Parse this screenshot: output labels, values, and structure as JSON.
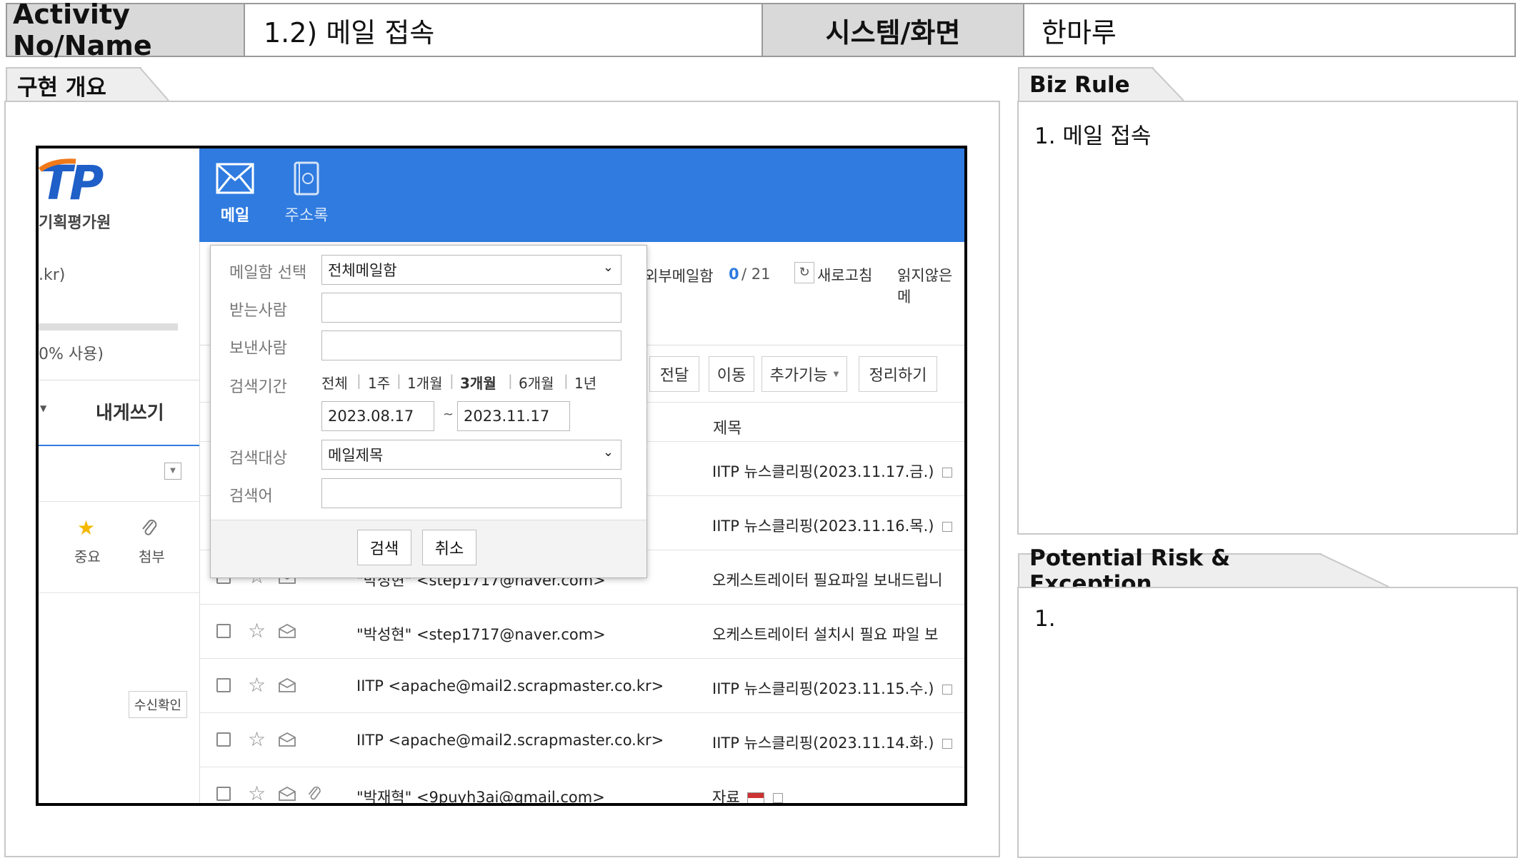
{
  "header": {
    "activity_label": "Activity No/Name",
    "activity_value": "1.2) 메일 접속",
    "system_label": "시스템/화면",
    "system_value": "한마루"
  },
  "sections": {
    "overview_title": "구현 개요",
    "biz_rule_title": "Biz Rule",
    "biz_rule_text": "1. 메일 접속",
    "risk_title": "Potential Risk & Exception",
    "risk_text": "1."
  },
  "mail_ui": {
    "logo_text": "TP",
    "org_name": "기획평가원",
    "nav": [
      {
        "label": "메일",
        "icon": "envelope-icon"
      },
      {
        "label": "주소록",
        "icon": "address-book-icon"
      }
    ],
    "account_suffix": ".kr)",
    "usage_text": "0% 사용)",
    "compose_label": "내게쓰기",
    "filters": {
      "important": "중요",
      "attachment": "첨부"
    },
    "receipt_label": "수신확인",
    "external_mailbox_label": "외부메일함",
    "external_count_unread": "0",
    "external_count_total": "/ 21",
    "refresh_label": "새로고침",
    "unread_label": "읽지않은메",
    "toolbar": [
      "전달",
      "이동",
      "추가기능",
      "정리하기"
    ],
    "subject_header": "제목",
    "rows": [
      {
        "sender": "",
        "subject": "IITP 뉴스클리핑(2023.11.17.금.)"
      },
      {
        "sender": "",
        "subject": "IITP 뉴스클리핑(2023.11.16.목.)"
      },
      {
        "sender": "\"박성현\" <step1717@naver.com>",
        "subject": "오케스트레이터 필요파일 보내드립니"
      },
      {
        "sender": "\"박성현\" <step1717@naver.com>",
        "subject": "오케스트레이터 설치시 필요 파일 보"
      },
      {
        "sender": "IITP <apache@mail2.scrapmaster.co.kr>",
        "subject": "IITP 뉴스클리핑(2023.11.15.수.)"
      },
      {
        "sender": "IITP <apache@mail2.scrapmaster.co.kr>",
        "subject": "IITP 뉴스클리핑(2023.11.14.화.)"
      },
      {
        "sender": "\"박재혁\" <9puyh3ai@gmail.com>",
        "subject": "자료"
      }
    ],
    "search_dialog": {
      "mailbox_label": "메일함 선택",
      "mailbox_value": "전체메일함",
      "to_label": "받는사람",
      "to_value": "",
      "from_label": "보낸사람",
      "from_value": "",
      "period_label": "검색기간",
      "period_options": [
        "전체",
        "1주",
        "1개월",
        "3개월",
        "6개월",
        "1년"
      ],
      "period_selected": "3개월",
      "date_from": "2023.08.17",
      "date_sep": "~",
      "date_to": "2023.11.17",
      "target_label": "검색대상",
      "target_value": "메일제목",
      "keyword_label": "검색어",
      "keyword_value": "",
      "search_button": "검색",
      "cancel_button": "취소"
    }
  },
  "colors": {
    "header_gray": "#d9d9d9",
    "mail_blue": "#2f7be0",
    "logo_orange": "#f07a1a",
    "logo_blue": "#1f5fc8"
  }
}
